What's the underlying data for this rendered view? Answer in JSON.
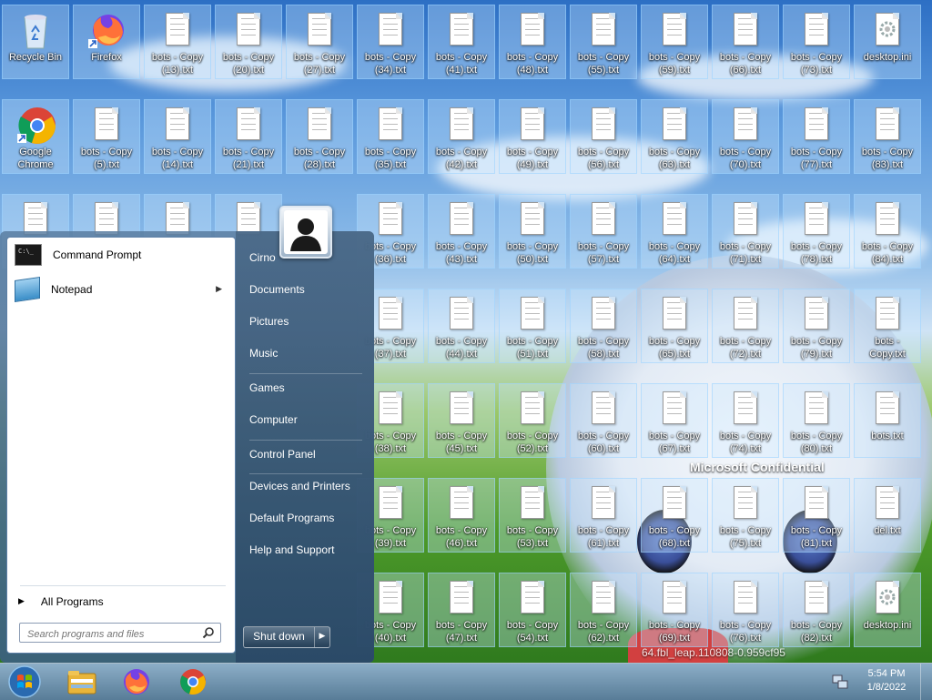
{
  "desktop_icons": [
    {
      "label": "Recycle Bin",
      "icon": "recycle-bin-icon"
    },
    {
      "label": "Firefox",
      "icon": "firefox-icon"
    },
    {
      "label": "bots - Copy (13).txt",
      "icon": "text-file-icon"
    },
    {
      "label": "bots - Copy (20).txt",
      "icon": "text-file-icon"
    },
    {
      "label": "bots - Copy (27).txt",
      "icon": "text-file-icon"
    },
    {
      "label": "bots - Copy (34).txt",
      "icon": "text-file-icon"
    },
    {
      "label": "bots - Copy (41).txt",
      "icon": "text-file-icon"
    },
    {
      "label": "bots - Copy (48).txt",
      "icon": "text-file-icon"
    },
    {
      "label": "bots - Copy (55).txt",
      "icon": "text-file-icon"
    },
    {
      "label": "bots - Copy (59).txt",
      "icon": "text-file-icon"
    },
    {
      "label": "bots - Copy (66).txt",
      "icon": "text-file-icon"
    },
    {
      "label": "bots - Copy (73).txt",
      "icon": "text-file-icon"
    },
    {
      "label": "desktop.ini",
      "icon": "settings-file-icon"
    },
    {
      "label": "Google Chrome",
      "icon": "chrome-icon"
    },
    {
      "label": "bots - Copy (5).txt",
      "icon": "text-file-icon"
    },
    {
      "label": "bots - Copy (14).txt",
      "icon": "text-file-icon"
    },
    {
      "label": "bots - Copy (21).txt",
      "icon": "text-file-icon"
    },
    {
      "label": "bots - Copy (28).txt",
      "icon": "text-file-icon"
    },
    {
      "label": "bots - Copy (35).txt",
      "icon": "text-file-icon"
    },
    {
      "label": "bots - Copy (42).txt",
      "icon": "text-file-icon"
    },
    {
      "label": "bots - Copy (49).txt",
      "icon": "text-file-icon"
    },
    {
      "label": "bots - Copy (56).txt",
      "icon": "text-file-icon"
    },
    {
      "label": "bots - Copy (63).txt",
      "icon": "text-file-icon"
    },
    {
      "label": "bots - Copy (70).txt",
      "icon": "text-file-icon"
    },
    {
      "label": "bots - Copy (77).txt",
      "icon": "text-file-icon"
    },
    {
      "label": "bots - Copy (83).txt",
      "icon": "text-file-icon"
    },
    {
      "label": "bots - Copy (36).txt",
      "icon": "text-file-icon"
    },
    {
      "label": "bots - Copy (43).txt",
      "icon": "text-file-icon"
    },
    {
      "label": "bots - Copy (50).txt",
      "icon": "text-file-icon"
    },
    {
      "label": "bots - Copy (57).txt",
      "icon": "text-file-icon"
    },
    {
      "label": "bots - Copy (64).txt",
      "icon": "text-file-icon"
    },
    {
      "label": "bots - Copy (71).txt",
      "icon": "text-file-icon"
    },
    {
      "label": "bots - Copy (78).txt",
      "icon": "text-file-icon"
    },
    {
      "label": "bots - Copy (84).txt",
      "icon": "text-file-icon"
    },
    {
      "label": "bots - Copy (37).txt",
      "icon": "text-file-icon"
    },
    {
      "label": "bots - Copy (44).txt",
      "icon": "text-file-icon"
    },
    {
      "label": "bots - Copy (51).txt",
      "icon": "text-file-icon"
    },
    {
      "label": "bots - Copy (58).txt",
      "icon": "text-file-icon"
    },
    {
      "label": "bots - Copy (65).txt",
      "icon": "text-file-icon"
    },
    {
      "label": "bots - Copy (72).txt",
      "icon": "text-file-icon"
    },
    {
      "label": "bots - Copy (79).txt",
      "icon": "text-file-icon"
    },
    {
      "label": "bots - Copy.txt",
      "icon": "text-file-icon"
    },
    {
      "label": "bots - Copy (38).txt",
      "icon": "text-file-icon"
    },
    {
      "label": "bots - Copy (45).txt",
      "icon": "text-file-icon"
    },
    {
      "label": "bots - Copy (52).txt",
      "icon": "text-file-icon"
    },
    {
      "label": "bots - Copy (60).txt",
      "icon": "text-file-icon"
    },
    {
      "label": "bots - Copy (67).txt",
      "icon": "text-file-icon"
    },
    {
      "label": "bots - Copy (74).txt",
      "icon": "text-file-icon"
    },
    {
      "label": "bots - Copy (80).txt",
      "icon": "text-file-icon"
    },
    {
      "label": "bots.txt",
      "icon": "text-file-icon"
    },
    {
      "label": "bots - Copy (39).txt",
      "icon": "text-file-icon"
    },
    {
      "label": "bots - Copy (46).txt",
      "icon": "text-file-icon"
    },
    {
      "label": "bots - Copy (53).txt",
      "icon": "text-file-icon"
    },
    {
      "label": "bots - Copy (61).txt",
      "icon": "text-file-icon"
    },
    {
      "label": "bots - Copy (68).txt",
      "icon": "text-file-icon"
    },
    {
      "label": "bots - Copy (75).txt",
      "icon": "text-file-icon"
    },
    {
      "label": "bots - Copy (81).txt",
      "icon": "text-file-icon"
    },
    {
      "label": "del.txt",
      "icon": "text-file-icon"
    },
    {
      "label": "bots - Copy (40).txt",
      "icon": "text-file-icon"
    },
    {
      "label": "bots - Copy (47).txt",
      "icon": "text-file-icon"
    },
    {
      "label": "bots - Copy (54).txt",
      "icon": "text-file-icon"
    },
    {
      "label": "bots - Copy (62).txt",
      "icon": "text-file-icon"
    },
    {
      "label": "bots - Copy (69).txt",
      "icon": "text-file-icon"
    },
    {
      "label": "bots - Copy (76).txt",
      "icon": "text-file-icon"
    },
    {
      "label": "bots - Copy (82).txt",
      "icon": "text-file-icon"
    },
    {
      "label": "desktop.ini",
      "icon": "settings-file-icon"
    }
  ],
  "watermark": {
    "title": "Microsoft Confidential",
    "build": "64.fbl_leap.110808-0.959cf95"
  },
  "start_menu": {
    "pinned_programs": [
      {
        "label": "Command Prompt",
        "icon": "command-prompt-icon",
        "has_submenu": false
      },
      {
        "label": "Notepad",
        "icon": "notepad-icon",
        "has_submenu": true
      }
    ],
    "all_programs_label": "All Programs",
    "search_placeholder": "Search programs and files",
    "user_name": "Cirno",
    "places": [
      "Cirno",
      "Documents",
      "Pictures",
      "Music",
      "Games",
      "Computer",
      "Control Panel",
      "Devices and Printers",
      "Default Programs",
      "Help and Support"
    ],
    "shutdown_label": "Shut down"
  },
  "taskbar": {
    "pinned": [
      "start-orb-icon",
      "file-explorer-icon",
      "firefox-icon",
      "chrome-icon"
    ],
    "clock_time": "5:54 PM",
    "clock_date": "1/8/2022"
  },
  "colors": {
    "selection_fill": "#cce8ff",
    "start_menu_glass": "#4a6f94"
  }
}
